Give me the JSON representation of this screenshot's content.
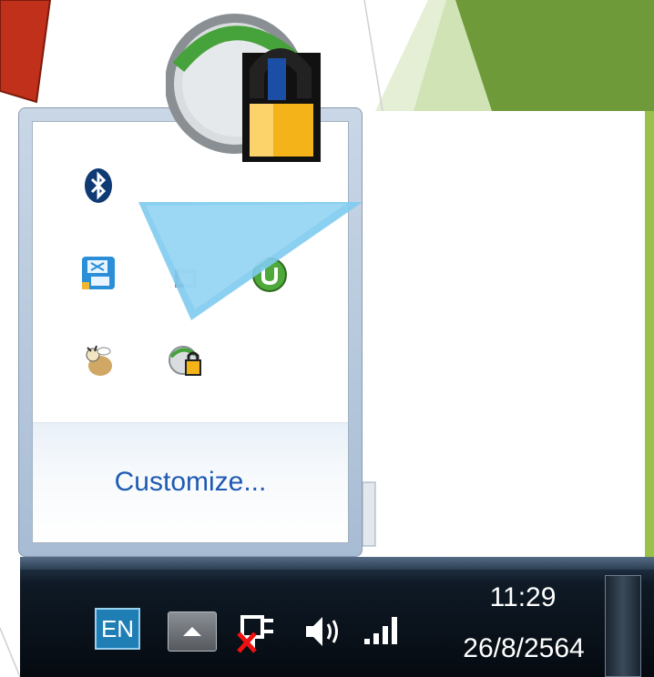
{
  "popup": {
    "customize_label": "Customize...",
    "icons": [
      {
        "name": "bluetooth-icon"
      },
      {
        "name": "input-panel-icon"
      },
      {
        "name": "network-icon"
      },
      {
        "name": "utorrent-icon"
      },
      {
        "name": "bee-app-icon"
      },
      {
        "name": "secure-network-icon"
      }
    ]
  },
  "taskbar": {
    "language": "EN",
    "time": "11:29",
    "date": "26/8/2564"
  },
  "colors": {
    "arrow_red": "#c0301b",
    "slide_green": "#6f9a3a",
    "callout_blue": "#7ecbf0",
    "link_blue": "#1e5ab2"
  }
}
